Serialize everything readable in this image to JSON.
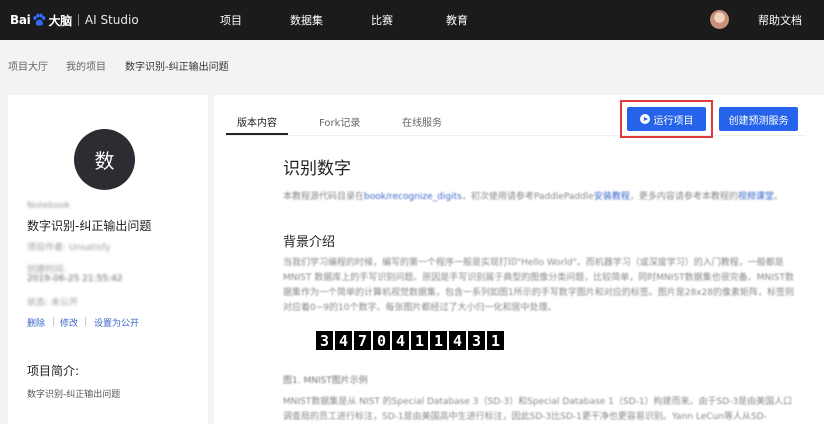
{
  "nav": {
    "logo_text": "Bai",
    "logo_brand_suffix": "大脑",
    "studio": "AI Studio",
    "links": [
      "项目",
      "数据集",
      "比赛",
      "教育"
    ],
    "help": "帮助文档"
  },
  "breadcrumb": {
    "items": [
      "项目大厅",
      "我的项目",
      "数字识别-纠正输出问题"
    ]
  },
  "project": {
    "avatar_char": "数",
    "owner_tag": "Notebook",
    "title": "数字识别-纠正输出问题",
    "author_line": "项目作者: Unsatisfy",
    "created_label": "创建时间:",
    "created_time": "2019-06-25 21:55:42",
    "status_line": "状态: 未公开",
    "actions": [
      "删除",
      "修改",
      "设置为公开"
    ],
    "intro_heading": "项目简介:",
    "intro_text": "数字识别-纠正输出问题"
  },
  "tabs": [
    "版本内容",
    "Fork记录",
    "在线服务"
  ],
  "buttons": {
    "run": "运行项目",
    "deploy": "创建预测服务"
  },
  "content": {
    "title": "识别数字",
    "intro_pre": "本教程源代码目录在",
    "intro_link": "book/recognize_digits",
    "intro_mid": "，初次使用请参考PaddlePaddle",
    "intro_link2": "安装教程",
    "intro_post": "，更多内容请参考本教程的",
    "intro_link3": "视频课堂",
    "intro_end": "。",
    "section_heading": "背景介绍",
    "bg_para": "当我们学习编程的时候，编写的第一个程序一般是实现打印\"Hello World\"。而机器学习（或深度学习）的入门教程，一般都是 MNIST 数据库上的手写识别问题。原因是手写识别属于典型的图像分类问题，比较简单，同时MNIST数据集也很完备。MNIST数据集作为一个简单的计算机视觉数据集，包含一系列如图1所示的手写数字图片和对应的标签。图片是28x28的像素矩阵，标签则对应着0~9的10个数字。每张图片都经过了大小归一化和居中处理。",
    "digits": [
      "3",
      "4",
      "7",
      "0",
      "4",
      "1",
      "1",
      "4",
      "3",
      "1"
    ],
    "figure_caption": "图1. MNIST图片示例",
    "bottom_para": "MNIST数据集是从 NIST 的Special Database 3（SD-3）和Special Database 1（SD-1）构建而来。由于SD-3是由美国人口调查局的员工进行标注，SD-1是由美国高中生进行标注，因此SD-3比SD-1更干净也更容易识别。Yann LeCun等人从SD-"
  }
}
